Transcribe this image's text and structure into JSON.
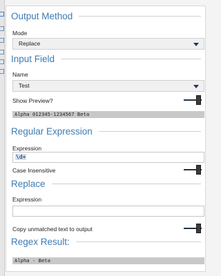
{
  "output_method": {
    "title": "Output Method",
    "mode_label": "Mode",
    "mode_value": "Replace"
  },
  "input_field": {
    "title": "Input Field",
    "name_label": "Name",
    "name_value": "Test",
    "show_preview_label": "Show Preview?",
    "show_preview_on": true,
    "preview_text": "Alpha 012345-1234567 Beta"
  },
  "regular_expression": {
    "title": "Regular Expression",
    "expression_label": "Expression",
    "expression_value": "\\d+",
    "case_insensitive_label": "Case Insensitive",
    "case_insensitive_on": true
  },
  "replace": {
    "title": "Replace",
    "expression_label": "Expression",
    "expression_value": "",
    "copy_unmatched_label": "Copy unmatched text to output",
    "copy_unmatched_on": true
  },
  "regex_result": {
    "title": "Regex Result:",
    "result_text": "Alpha - Beta"
  },
  "colors": {
    "section_title": "#3d7bb3",
    "toggle_track": "#1f3348",
    "dropdown_arrow": "#1e3a5c",
    "output_bar": "#c8c8c8"
  }
}
